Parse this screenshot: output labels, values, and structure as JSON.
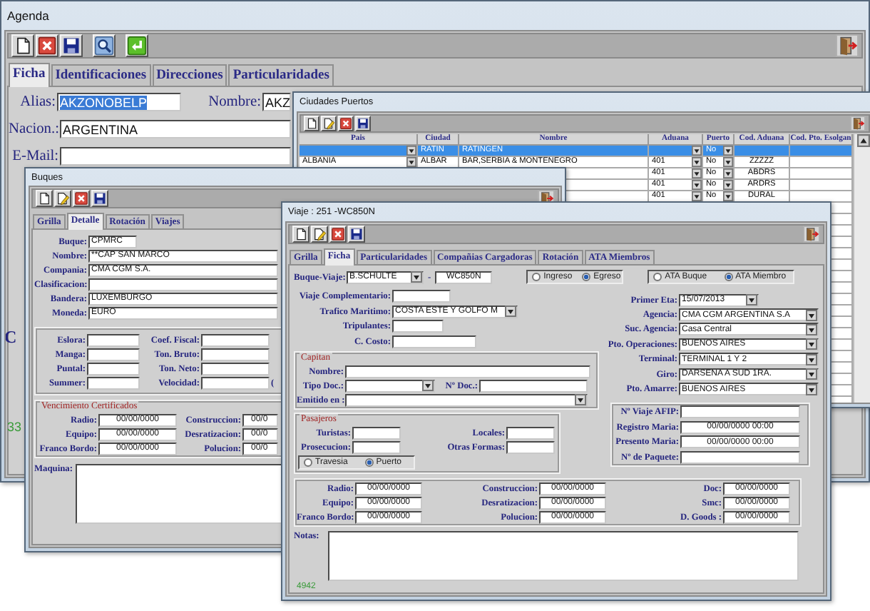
{
  "agenda": {
    "title": "Agenda",
    "tabs": [
      {
        "label": "Ficha",
        "selected": true
      },
      {
        "label": "Identificaciones",
        "selected": false
      },
      {
        "label": "Direcciones",
        "selected": false
      },
      {
        "label": "Particularidades",
        "selected": false
      }
    ],
    "fields": [
      {
        "label": "Alias:",
        "value": "AKZONOBELP",
        "kind": "text",
        "highlighted": true
      },
      {
        "label": "Nombre:",
        "value": "AKZ",
        "kind": "text",
        "highlighted": false
      },
      {
        "label": "Nacion.:",
        "value": "ARGENTINA",
        "kind": "text",
        "highlighted": false
      },
      {
        "label": "E-Mail:",
        "kind": "text"
      }
    ],
    "partial_label": "C",
    "record_number": "33"
  },
  "ciudades_puertos": {
    "title": "Ciudades Puertos",
    "columns": [
      "Pais",
      "Ciudad",
      "Nombre",
      "Aduana",
      "Puerto",
      "Cod. Aduana",
      "Cod. Pto. Esolgan"
    ],
    "rows": [
      {
        "selected": true,
        "ciudad": "RATIN",
        "nombre": "RATINGEN",
        "puerto": "No"
      },
      {
        "selected": false,
        "pais": "ALBANIA",
        "ciudad": "ALBAR",
        "nombre": "BAR,SERBIA & MONTENEGRO",
        "aduana": "401",
        "puerto": "No",
        "cod_aduana": "ZZZZZ"
      },
      {
        "selected": false,
        "aduana": "401",
        "puerto": "No",
        "cod_aduana": "ABDRS"
      },
      {
        "selected": false,
        "aduana": "401",
        "puerto": "No",
        "cod_aduana": "ARDRS"
      },
      {
        "selected": false,
        "aduana": "401",
        "puerto": "No",
        "cod_aduana": "DURAL"
      }
    ]
  },
  "buques": {
    "title": "Buques",
    "tabs": [
      {
        "label": "Grilla",
        "selected": false
      },
      {
        "label": "Detalle",
        "selected": true
      },
      {
        "label": "Rotación",
        "selected": false
      },
      {
        "label": "Viajes",
        "selected": false
      }
    ],
    "fields": [
      {
        "label": "Buque:",
        "value": "CPMRC",
        "kind": "text"
      },
      {
        "label": "Nombre:",
        "value": "**CAP SAN MARCO",
        "kind": "text"
      },
      {
        "label": "Compania:",
        "value": "CMA CGM S.A.",
        "kind": "text"
      },
      {
        "label": "Clasificacion:",
        "kind": "text"
      },
      {
        "label": "Bandera:",
        "value": "LUXEMBURGO",
        "kind": "text"
      },
      {
        "label": "Moneda:",
        "value": "EURO",
        "kind": "text"
      }
    ],
    "medidas": [
      [
        {
          "label": "Eslora:",
          "kind": "text"
        },
        {
          "label": "Coef. Fiscal:",
          "kind": "text"
        }
      ],
      [
        {
          "label": "Manga:",
          "kind": "text"
        },
        {
          "label": "Ton. Bruto:",
          "kind": "text"
        }
      ],
      [
        {
          "label": "Puntal:",
          "kind": "text"
        },
        {
          "label": "Ton. Neto:",
          "kind": "text"
        }
      ],
      [
        {
          "label": "Summer:",
          "kind": "text"
        },
        {
          "label": "Velocidad:",
          "kind": "text"
        }
      ]
    ],
    "medidas_suffix": "(",
    "certificados": {
      "title": "Vencimiento Certificados",
      "rows": [
        [
          {
            "label": "Radio:",
            "value": "00/00/0000",
            "kind": "date"
          },
          {
            "label": "Construccion:",
            "value": "00/0",
            "kind": "date"
          }
        ],
        [
          {
            "label": "Equipo:",
            "value": "00/00/0000",
            "kind": "date"
          },
          {
            "label": "Desratizacion:",
            "value": "00/0",
            "kind": "date"
          }
        ],
        [
          {
            "label": "Franco Bordo:",
            "value": "00/00/0000",
            "kind": "date"
          },
          {
            "label": "Polucion:",
            "value": "00/0",
            "kind": "date"
          }
        ]
      ]
    },
    "maquina": {
      "label": "Maquina:",
      "kind": "area"
    }
  },
  "viaje": {
    "title": "Viaje : 251  -WC850N",
    "tabs": [
      {
        "label": "Grilla",
        "selected": false
      },
      {
        "label": "Ficha",
        "selected": true
      },
      {
        "label": "Particularidades",
        "selected": false
      },
      {
        "label": "Compañias Cargadoras",
        "selected": false
      },
      {
        "label": "Rotación",
        "selected": false
      },
      {
        "label": "ATA Miembros",
        "selected": false
      }
    ],
    "buque_viaje": {
      "label": "Buque-Viaje:",
      "value": "B.SCHULTE",
      "kind": "combo"
    },
    "separator": "-",
    "viaje_numero": {
      "value": "WC850N",
      "kind": "date"
    },
    "movimiento": [
      {
        "label": "Ingreso",
        "selected": false
      },
      {
        "label": "Egreso",
        "selected": true
      }
    ],
    "ata": [
      {
        "label": "ATA Buque",
        "selected": false
      },
      {
        "label": "ATA Miembro",
        "selected": true
      }
    ],
    "general": [
      {
        "label": "Viaje Complementario:",
        "kind": "text"
      },
      {
        "label": "Trafico Maritimo:",
        "value": "COSTA ESTE Y GOLFO M",
        "kind": "combo"
      },
      {
        "label": "Tripulantes:",
        "kind": "text"
      },
      {
        "label": "C. Costo:",
        "kind": "text"
      }
    ],
    "capitan": {
      "title": "Capitan",
      "rows": [
        [
          {
            "label": "Nombre:",
            "kind": "text"
          }
        ],
        [
          {
            "label": "Tipo Doc.:",
            "kind": "combo"
          },
          {
            "label": "Nº Doc.:",
            "kind": "text"
          }
        ],
        [
          {
            "label": "Emitido en :",
            "kind": "combo"
          }
        ]
      ]
    },
    "pasajeros": {
      "title": "Pasajeros",
      "rows": [
        [
          {
            "label": "Turistas:",
            "kind": "text"
          },
          {
            "label": "Locales:",
            "kind": "text"
          }
        ],
        [
          {
            "label": "Prosecucion:",
            "kind": "text"
          },
          {
            "label": "Otras Formas:",
            "kind": "text"
          }
        ]
      ],
      "modo": [
        {
          "label": "Travesia",
          "selected": false
        },
        {
          "label": "Puerto",
          "selected": true
        }
      ]
    },
    "operacion": [
      {
        "label": "Primer Eta:",
        "value": "15/07/2013",
        "kind": "combo"
      },
      {
        "label": "Agencia:",
        "value": "CMA CGM ARGENTINA S.A",
        "kind": "combo"
      },
      {
        "label": "Suc. Agencia:",
        "value": "Casa Central",
        "kind": "combo"
      },
      {
        "label": "Pto. Operaciones:",
        "value": "BUENOS AIRES",
        "kind": "combo"
      },
      {
        "label": "Terminal:",
        "value": "TERMINAL 1 Y 2",
        "kind": "combo"
      },
      {
        "label": "Giro:",
        "value": "DARSENA A SUD 1RA.",
        "kind": "combo"
      },
      {
        "label": "Pto. Amarre:",
        "value": "BUENOS AIRES",
        "kind": "combo"
      }
    ],
    "afip": [
      {
        "label": "Nº Viaje AFIP:",
        "kind": "text"
      },
      {
        "label": "Registro Maria:",
        "value": "00/00/0000 00:00",
        "kind": "date"
      },
      {
        "label": "Presento Maria:",
        "value": "00/00/0000 00:00",
        "kind": "date"
      },
      {
        "label": "Nº de Paquete:",
        "kind": "text"
      }
    ],
    "certificados": [
      [
        {
          "label": "Radio:",
          "value": "00/00/0000",
          "kind": "date"
        },
        {
          "label": "Construccion:",
          "value": "00/00/0000",
          "kind": "date"
        },
        {
          "label": "Doc:",
          "value": "00/00/0000",
          "kind": "date"
        }
      ],
      [
        {
          "label": "Equipo:",
          "value": "00/00/0000",
          "kind": "date"
        },
        {
          "label": "Desratizacion:",
          "value": "00/00/0000",
          "kind": "date"
        },
        {
          "label": "Smc:",
          "value": "00/00/0000",
          "kind": "date"
        }
      ],
      [
        {
          "label": "Franco Bordo:",
          "value": "00/00/0000",
          "kind": "date"
        },
        {
          "label": "Polucion:",
          "value": "00/00/0000",
          "kind": "date"
        },
        {
          "label": "D. Goods :",
          "value": "00/00/0000",
          "kind": "date"
        }
      ]
    ],
    "notas": {
      "label": "Notas:",
      "kind": "area"
    },
    "record_number": "4942"
  }
}
